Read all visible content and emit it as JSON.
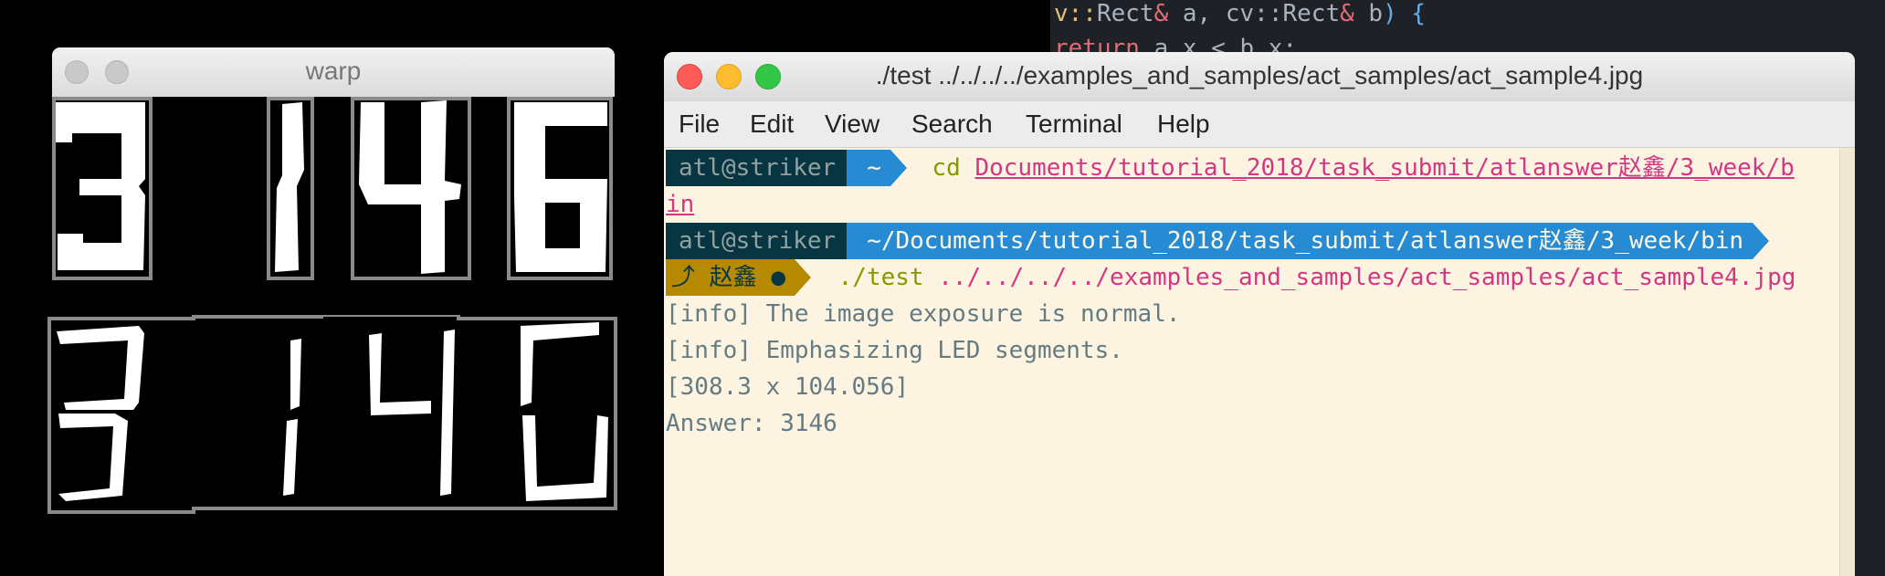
{
  "editor": {
    "line1": {
      "t1": "v::",
      "t2": "Rect",
      "t3": "&",
      "t4": " a, cv::",
      "t5": "Rect",
      "t6": "&",
      "t7": " b",
      "t8": ") {"
    },
    "line2": {
      "t1": "return",
      "t2": " a.x < b.x;"
    }
  },
  "warp_window": {
    "title": "warp",
    "digits": [
      "3",
      "1",
      "4",
      "6"
    ]
  },
  "terminal": {
    "title": "./test ../../../../examples_and_samples/act_samples/act_sample4.jpg",
    "menu": [
      "File",
      "Edit",
      "View",
      "Search",
      "Terminal",
      "Help"
    ],
    "prompt1": {
      "user": "atl@striker",
      "path": "~",
      "command": "cd",
      "arg_part1": "Documents/tutorial_2018/task_submit/atlanswer赵鑫/3_week/b",
      "arg_part2": "in"
    },
    "prompt2": {
      "user": "atl@striker",
      "path": "~/Documents/tutorial_2018/task_submit/atlanswer赵鑫/3_week/bin",
      "git_branch": "赵鑫 ●",
      "git_icon": "branch-icon",
      "command": "./test",
      "arg": "../../../../examples_and_samples/act_samples/act_sample4.jpg"
    },
    "output": [
      "[info] The image exposure is normal.",
      "[info] Emphasizing LED segments.",
      "[308.3 x 104.056]",
      "Answer: 3146"
    ]
  }
}
